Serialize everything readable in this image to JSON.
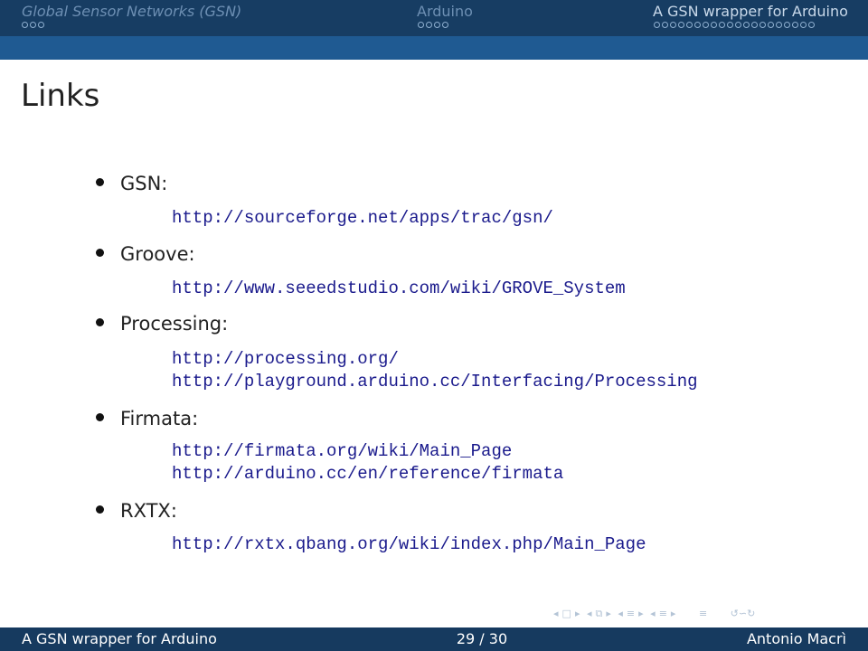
{
  "header": {
    "sections": [
      {
        "title": "Global Sensor Networks (GSN)",
        "dots": 3,
        "active": false
      },
      {
        "title": "Arduino",
        "dots": 4,
        "active": false
      },
      {
        "title": "A GSN wrapper for Arduino",
        "dots": 20,
        "active": true
      }
    ]
  },
  "frame": {
    "title": "Links"
  },
  "items": [
    {
      "label": "GSN:",
      "urls": [
        "http://sourceforge.net/apps/trac/gsn/"
      ]
    },
    {
      "label": "Groove:",
      "urls": [
        "http://www.seeedstudio.com/wiki/GROVE_System"
      ]
    },
    {
      "label": "Processing:",
      "urls": [
        "http://processing.org/",
        "http://playground.arduino.cc/Interfacing/Processing"
      ]
    },
    {
      "label": "Firmata:",
      "urls": [
        "http://firmata.org/wiki/Main_Page",
        "http://arduino.cc/en/reference/firmata"
      ]
    },
    {
      "label": "RXTX:",
      "urls": [
        "http://rxtx.qbang.org/wiki/index.php/Main_Page"
      ]
    }
  ],
  "footer": {
    "title": "A GSN wrapper for Arduino",
    "page": "29 / 30",
    "author": "Antonio Macrì"
  },
  "colors": {
    "header_bg": "#173d63",
    "subbar_bg": "#1f5a92",
    "url": "#1a1a8c",
    "footer_bg": "#163a5f"
  }
}
